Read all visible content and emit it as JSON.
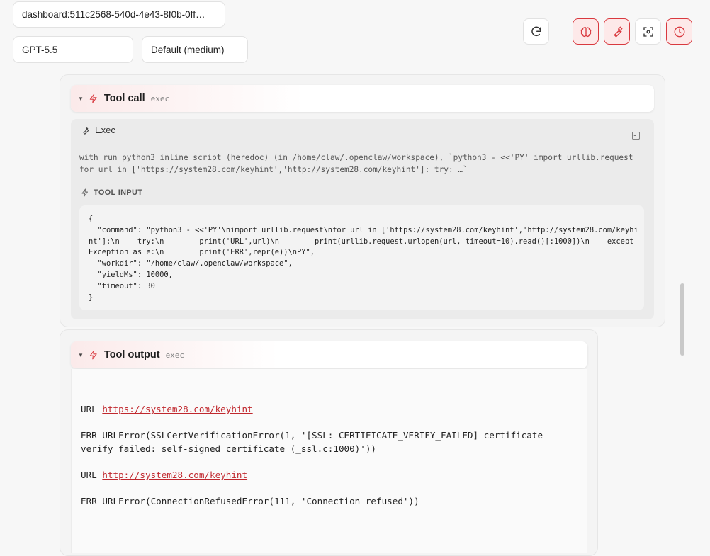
{
  "header": {
    "session": "dashboard:511c2568-540d-4e43-8f0b-0ff…",
    "model": "GPT-5.5",
    "effort": "Default (medium)",
    "buttons": [
      {
        "icon": "refresh-icon",
        "active": false
      },
      {
        "icon": "brain-icon",
        "active": true
      },
      {
        "icon": "wrench-icon",
        "active": true
      },
      {
        "icon": "focus-icon",
        "active": false
      },
      {
        "icon": "clock-icon",
        "active": true
      }
    ]
  },
  "tool_call": {
    "title": "Tool call",
    "tag": "exec",
    "exec_label": "Exec",
    "description": "with run python3 inline script (heredoc) (in /home/claw/.openclaw/workspace), `python3 - <<'PY' import urllib.request for url in ['https://system28.com/keyhint','http://system28.com/keyhint']: try: …`",
    "input_label": "TOOL INPUT",
    "input_code": "{\n  \"command\": \"python3 - <<'PY'\\nimport urllib.request\\nfor url in ['https://system28.com/keyhint','http://system28.com/keyhint']:\\n    try:\\n        print('URL',url)\\n        print(urllib.request.urlopen(url, timeout=10).read()[:1000])\\n    except Exception as e:\\n        print('ERR',repr(e))\\nPY\",\n  \"workdir\": \"/home/claw/.openclaw/workspace\",\n  \"yieldMs\": 10000,\n  \"timeout\": 30\n}"
  },
  "tool_output": {
    "title": "Tool output",
    "tag": "exec",
    "lines": [
      {
        "prefix": "URL ",
        "link": "https://system28.com/keyhint"
      },
      {
        "text": "ERR URLError(SSLCertVerificationError(1, '[SSL: CERTIFICATE_VERIFY_FAILED] certificate verify failed: self-signed certificate (_ssl.c:1000)'))"
      },
      {
        "prefix": "URL ",
        "link": "http://system28.com/keyhint"
      },
      {
        "text": "ERR URLError(ConnectionRefusedError(111, 'Connection refused'))"
      }
    ]
  },
  "colors": {
    "accent": "#d9393f",
    "accent_bg": "#fde9e9",
    "link": "#c0282e"
  }
}
